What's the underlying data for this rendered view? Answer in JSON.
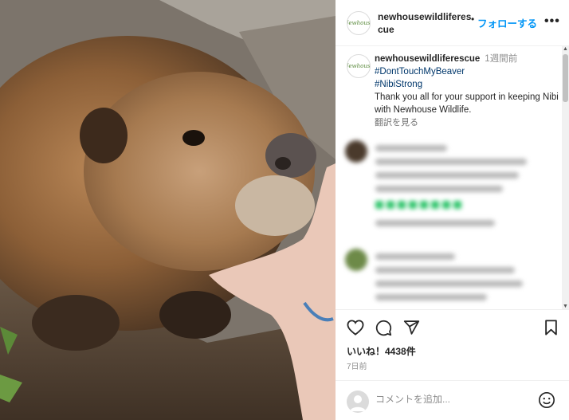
{
  "post": {
    "username": "newhousewildliferescue",
    "follow_label": "フォローする",
    "separator": "•",
    "more_label": "•••",
    "avatar_text": "Newhouse"
  },
  "caption": {
    "username": "newhousewildliferescue",
    "time_ago": "1週間前",
    "hashtags": [
      "#DontTouchMyBeaver",
      "#NibiStrong"
    ],
    "text": "Thank you all for your support in keeping Nibi with Newhouse Wildlife.",
    "translate_label": "翻訳を見る"
  },
  "actions": {
    "likes_label": "いいね！4438件",
    "date_label": "7日前"
  },
  "comment": {
    "placeholder": "コメントを追加..."
  },
  "icons": {
    "like": "heart-icon",
    "comment": "comment-icon",
    "share": "paper-plane-icon",
    "save": "bookmark-icon",
    "emoji": "smiley-icon",
    "more": "ellipsis-icon"
  },
  "colors": {
    "accent": "#0095f6",
    "hashtag": "#00376b",
    "muted": "#8e8e8e"
  }
}
